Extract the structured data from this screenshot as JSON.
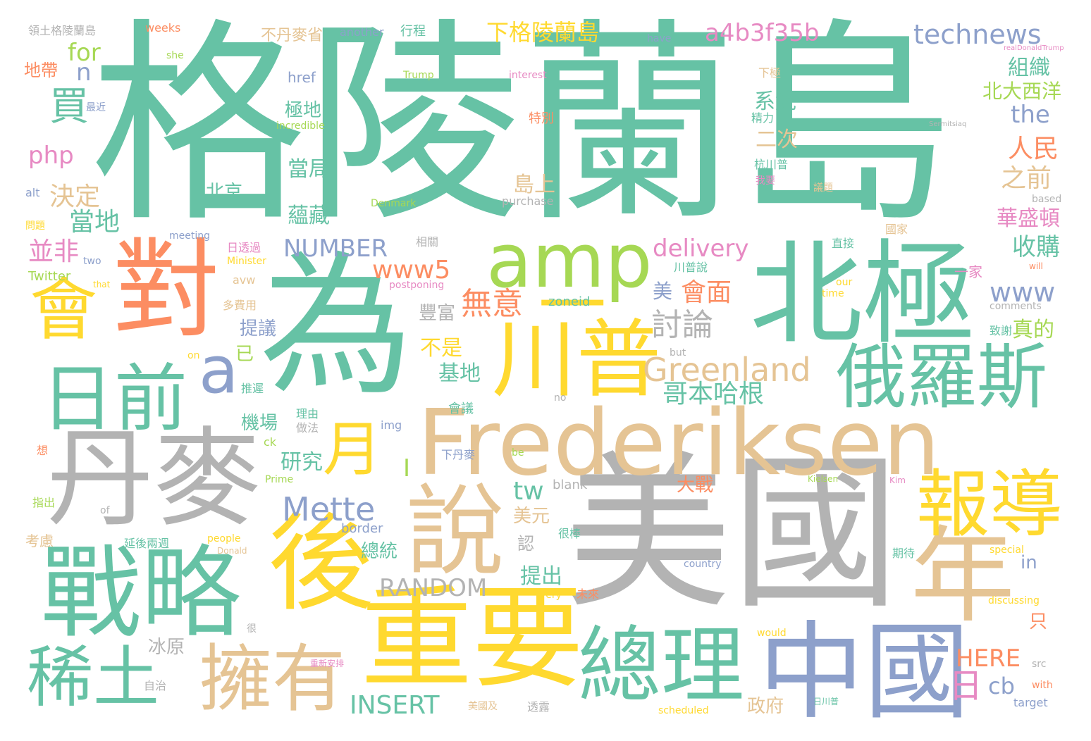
{
  "palette": {
    "green": "#66c2a5",
    "orange": "#fc8d62",
    "blue": "#8da0cb",
    "pink": "#e78ac3",
    "lime": "#a6d854",
    "yellow": "#ffd92f",
    "tan": "#e5c494",
    "gray": "#b3b3b3"
  },
  "words": [
    {
      "text": "格陵蘭島",
      "color": "green"
    },
    {
      "text": "為",
      "color": "green"
    },
    {
      "text": "美國",
      "color": "gray"
    },
    {
      "text": "Frederiksen",
      "color": "tan"
    },
    {
      "text": "丹麥",
      "color": "gray"
    },
    {
      "text": "北極",
      "color": "green"
    },
    {
      "text": "重要",
      "color": "yellow"
    },
    {
      "text": "戰略",
      "color": "green"
    },
    {
      "text": "對",
      "color": "orange"
    },
    {
      "text": "後",
      "color": "yellow"
    },
    {
      "text": "說",
      "color": "tan"
    },
    {
      "text": "中國",
      "color": "blue"
    },
    {
      "text": "年",
      "color": "tan"
    },
    {
      "text": "總理",
      "color": "green"
    },
    {
      "text": "川普",
      "color": "yellow"
    },
    {
      "text": "俄羅斯",
      "color": "green"
    },
    {
      "text": "報導",
      "color": "yellow"
    },
    {
      "text": "擁有",
      "color": "tan"
    },
    {
      "text": "稀土",
      "color": "green"
    },
    {
      "text": "日前",
      "color": "green"
    },
    {
      "text": "amp",
      "color": "lime"
    },
    {
      "text": "會",
      "color": "yellow"
    },
    {
      "text": "a",
      "color": "blue"
    },
    {
      "text": "一",
      "color": "yellow"
    },
    {
      "text": "月",
      "color": "yellow"
    },
    {
      "text": "Greenland",
      "color": "tan"
    },
    {
      "text": "Mette",
      "color": "blue"
    },
    {
      "text": "technews",
      "color": "blue"
    },
    {
      "text": "a4b3f35b",
      "color": "pink"
    },
    {
      "text": "www5",
      "color": "orange"
    },
    {
      "text": "NUMBER",
      "color": "blue"
    },
    {
      "text": "RANDOM",
      "color": "gray"
    },
    {
      "text": "INSERT",
      "color": "green"
    },
    {
      "text": "買",
      "color": "green"
    },
    {
      "text": "下格陵蘭島",
      "color": "yellow"
    },
    {
      "text": "delivery",
      "color": "pink"
    },
    {
      "text": "無意",
      "color": "orange"
    },
    {
      "text": "討論",
      "color": "gray"
    },
    {
      "text": "哥本哈根",
      "color": "green"
    },
    {
      "text": "www",
      "color": "blue"
    },
    {
      "text": "會面",
      "color": "orange"
    },
    {
      "text": "HERE",
      "color": "orange"
    },
    {
      "text": "cb",
      "color": "blue"
    },
    {
      "text": "日",
      "color": "pink"
    },
    {
      "text": "tw",
      "color": "green"
    },
    {
      "text": "for",
      "color": "lime"
    },
    {
      "text": "n",
      "color": "blue"
    },
    {
      "text": "php",
      "color": "pink"
    },
    {
      "text": "the",
      "color": "blue"
    },
    {
      "text": "決定",
      "color": "tan"
    },
    {
      "text": "當地",
      "color": "green"
    },
    {
      "text": "並非",
      "color": "pink"
    },
    {
      "text": "北京",
      "color": "green"
    },
    {
      "text": "人民",
      "color": "orange"
    },
    {
      "text": "之前",
      "color": "tan"
    },
    {
      "text": "華盛頓",
      "color": "pink"
    },
    {
      "text": "收購",
      "color": "green"
    },
    {
      "text": "組織",
      "color": "green"
    },
    {
      "text": "北大西洋",
      "color": "lime"
    },
    {
      "text": "系統",
      "color": "green"
    },
    {
      "text": "二次",
      "color": "tan"
    },
    {
      "text": "當局",
      "color": "green"
    },
    {
      "text": "蘊藏",
      "color": "green"
    },
    {
      "text": "極地",
      "color": "green"
    },
    {
      "text": "島上",
      "color": "tan"
    },
    {
      "text": "不丹麥省",
      "color": "tan"
    },
    {
      "text": "真的",
      "color": "lime"
    },
    {
      "text": "不是",
      "color": "yellow"
    },
    {
      "text": "基地",
      "color": "green"
    },
    {
      "text": "豐富",
      "color": "gray"
    },
    {
      "text": "機場",
      "color": "green"
    },
    {
      "text": "研究",
      "color": "green"
    },
    {
      "text": "提議",
      "color": "blue"
    },
    {
      "text": "提出",
      "color": "green"
    },
    {
      "text": "總統",
      "color": "green"
    },
    {
      "text": "美元",
      "color": "tan"
    },
    {
      "text": "大戰",
      "color": "orange"
    },
    {
      "text": "冰原",
      "color": "gray"
    },
    {
      "text": "政府",
      "color": "tan"
    },
    {
      "text": "只",
      "color": "orange"
    },
    {
      "text": "in",
      "color": "blue"
    },
    {
      "text": "I",
      "color": "lime"
    },
    {
      "text": "已",
      "color": "lime"
    },
    {
      "text": "美",
      "color": "blue"
    },
    {
      "text": "認",
      "color": "gray"
    },
    {
      "text": "地帶",
      "color": "orange"
    },
    {
      "text": "領土格陵蘭島",
      "color": "gray"
    },
    {
      "text": "weeks",
      "color": "orange"
    },
    {
      "text": "another",
      "color": "blue"
    },
    {
      "text": "行程",
      "color": "green"
    },
    {
      "text": "she",
      "color": "lime"
    },
    {
      "text": "have",
      "color": "blue"
    },
    {
      "text": "href",
      "color": "blue"
    },
    {
      "text": "Trump",
      "color": "lime"
    },
    {
      "text": "interest",
      "color": "pink"
    },
    {
      "text": "最近",
      "color": "blue"
    },
    {
      "text": "incredible",
      "color": "lime"
    },
    {
      "text": "特別",
      "color": "orange"
    },
    {
      "text": "alt",
      "color": "blue"
    },
    {
      "text": "我要",
      "color": "pink"
    },
    {
      "text": "杭川普",
      "color": "green"
    },
    {
      "text": "議題",
      "color": "tan"
    },
    {
      "text": "Denmark",
      "color": "lime"
    },
    {
      "text": "purchase",
      "color": "gray"
    },
    {
      "text": "問題",
      "color": "yellow"
    },
    {
      "text": "meeting",
      "color": "blue"
    },
    {
      "text": "日透過",
      "color": "pink"
    },
    {
      "text": "Minister",
      "color": "yellow"
    },
    {
      "text": "相關",
      "color": "gray"
    },
    {
      "text": "直接",
      "color": "green"
    },
    {
      "text": "國家",
      "color": "tan"
    },
    {
      "text": "川普說",
      "color": "green"
    },
    {
      "text": "two",
      "color": "blue"
    },
    {
      "text": "Twitter",
      "color": "lime"
    },
    {
      "text": "that",
      "color": "yellow"
    },
    {
      "text": "avw",
      "color": "tan"
    },
    {
      "text": "postponing",
      "color": "pink"
    },
    {
      "text": "our",
      "color": "yellow"
    },
    {
      "text": "time",
      "color": "yellow"
    },
    {
      "text": "一家",
      "color": "pink"
    },
    {
      "text": "will",
      "color": "orange"
    },
    {
      "text": "多費用",
      "color": "tan"
    },
    {
      "text": "zoneid",
      "color": "green"
    },
    {
      "text": "comments",
      "color": "gray"
    },
    {
      "text": "致謝",
      "color": "green"
    },
    {
      "text": "on",
      "color": "yellow"
    },
    {
      "text": "but",
      "color": "gray"
    },
    {
      "text": "推遲",
      "color": "green"
    },
    {
      "text": "理由",
      "color": "green"
    },
    {
      "text": "做法",
      "color": "gray"
    },
    {
      "text": "img",
      "color": "blue"
    },
    {
      "text": "會議",
      "color": "green"
    },
    {
      "text": "no",
      "color": "gray"
    },
    {
      "text": "想",
      "color": "orange"
    },
    {
      "text": "ck",
      "color": "lime"
    },
    {
      "text": "下丹麥",
      "color": "blue"
    },
    {
      "text": "be",
      "color": "lime"
    },
    {
      "text": "Prime",
      "color": "lime"
    },
    {
      "text": "blank",
      "color": "gray"
    },
    {
      "text": "Kielsen",
      "color": "lime"
    },
    {
      "text": "Kim",
      "color": "pink"
    },
    {
      "text": "指出",
      "color": "lime"
    },
    {
      "text": "of",
      "color": "gray"
    },
    {
      "text": "border",
      "color": "blue"
    },
    {
      "text": "考慮",
      "color": "tan"
    },
    {
      "text": "延後兩週",
      "color": "green"
    },
    {
      "text": "people",
      "color": "yellow"
    },
    {
      "text": "很棒",
      "color": "green"
    },
    {
      "text": "Donald",
      "color": "tan"
    },
    {
      "text": "special",
      "color": "yellow"
    },
    {
      "text": "期待",
      "color": "green"
    },
    {
      "text": "country",
      "color": "blue"
    },
    {
      "text": "very",
      "color": "yellow"
    },
    {
      "text": "未來",
      "color": "orange"
    },
    {
      "text": "discussing",
      "color": "yellow"
    },
    {
      "text": "很",
      "color": "gray"
    },
    {
      "text": "would",
      "color": "yellow"
    },
    {
      "text": "src",
      "color": "gray"
    },
    {
      "text": "with",
      "color": "orange"
    },
    {
      "text": "target",
      "color": "blue"
    },
    {
      "text": "自治",
      "color": "gray"
    },
    {
      "text": "重新安排",
      "color": "pink"
    },
    {
      "text": "美國及",
      "color": "tan"
    },
    {
      "text": "透露",
      "color": "gray"
    },
    {
      "text": "scheduled",
      "color": "yellow"
    },
    {
      "text": "日川普",
      "color": "green"
    },
    {
      "text": "下極",
      "color": "tan"
    },
    {
      "text": "精力",
      "color": "green"
    },
    {
      "text": "based",
      "color": "gray"
    },
    {
      "text": "realDonaldTrump",
      "color": "pink"
    },
    {
      "text": "Sermitsiaq",
      "color": "gray"
    }
  ]
}
